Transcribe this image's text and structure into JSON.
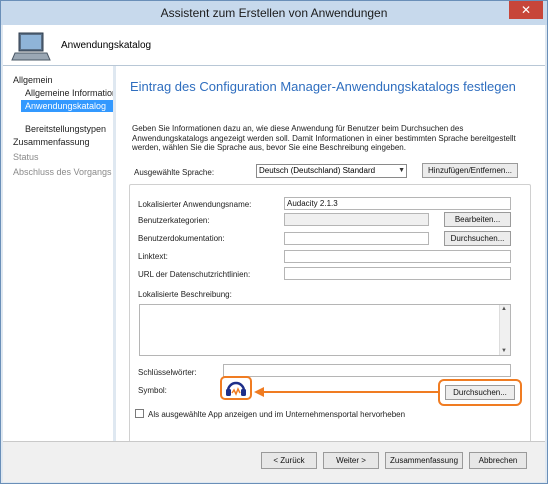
{
  "window": {
    "title": "Assistent zum Erstellen von Anwendungen",
    "close_glyph": "✕"
  },
  "header": {
    "title": "Anwendungskatalog",
    "icon": "computer-icon"
  },
  "nav": {
    "items": [
      {
        "label": "Allgemein"
      },
      {
        "label": "Allgemeine Informatione"
      },
      {
        "label": "Anwendungskatalog"
      },
      {
        "label": "Bereitstellungstypen"
      },
      {
        "label": "Zusammenfassung"
      },
      {
        "label": "Status"
      },
      {
        "label": "Abschluss des Vorgangs"
      }
    ]
  },
  "main": {
    "title": "Eintrag des Configuration Manager-Anwendungskatalogs festlegen",
    "intro": "Geben Sie Informationen dazu an, wie diese Anwendung für Benutzer beim Durchsuchen des Anwendungskatalogs angezeigt werden soll. Damit Informationen in einer bestimmten Sprache bereitgestellt werden, wählen Sie die Sprache aus, bevor Sie eine Beschreibung eingeben.",
    "language": {
      "label": "Ausgewählte Sprache:",
      "value": "Deutsch (Deutschland) Standard",
      "add_button": "Hinzufügen/Entfernen..."
    },
    "fields": {
      "localized_name": {
        "label": "Lokalisierter Anwendungsname:",
        "value": "Audacity 2.1.3"
      },
      "categories": {
        "label": "Benutzerkategorien:",
        "value": "",
        "button": "Bearbeiten..."
      },
      "documentation": {
        "label": "Benutzerdokumentation:",
        "value": "",
        "button": "Durchsuchen..."
      },
      "link_text": {
        "label": "Linktext:",
        "value": ""
      },
      "privacy_url": {
        "label": "URL der Datenschutzrichtlinien:",
        "value": ""
      },
      "description": {
        "label": "Lokalisierte Beschreibung:",
        "value": ""
      },
      "keywords": {
        "label": "Schlüsselwörter:",
        "value": ""
      },
      "icon": {
        "label": "Symbol:",
        "button": "Durchsuchen...",
        "icon_name": "headphones-icon"
      }
    },
    "featured_checkbox": {
      "label": "Als ausgewählte App anzeigen und im Unternehmensportal hervorheben",
      "checked": false
    }
  },
  "footer": {
    "back": "< Zurück",
    "next": "Weiter >",
    "summary": "Zusammenfassung",
    "cancel": "Abbrechen"
  },
  "colors": {
    "accent": "#2f6ebf",
    "highlight": "#f07c22",
    "selection": "#3399ff",
    "close": "#c7463a"
  }
}
